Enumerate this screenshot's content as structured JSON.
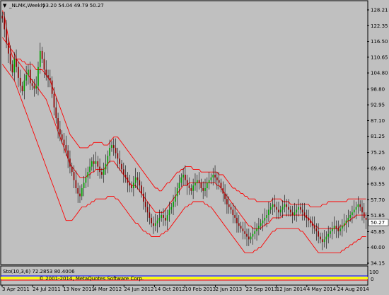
{
  "window": {
    "symbol_title": "_NLMK,Weekly",
    "ohlc": "53.20 54.04 49.79 50.27",
    "current_price": "50.27",
    "copyright": "© 2001-2014, MetaQuotes Software Corp."
  },
  "subwindow": {
    "indicator_label": "Sto(10,3,6) 72.2853 80.4006",
    "max_label": "100",
    "min_label": "0"
  },
  "colors": {
    "background": "#c0c0c0",
    "bollinger": "#ff0000",
    "bull_candle": "#00a000",
    "bear_candle": "#8b0000",
    "grid": "#ffffff",
    "stochastic_main": "#0000ff",
    "stochastic_signal": "#ff0000"
  },
  "chart_data": {
    "type": "candlestick",
    "y_axis_labels": [
      "128.21",
      "122.35",
      "116.50",
      "110.65",
      "104.80",
      "98.80",
      "92.95",
      "87.10",
      "81.25",
      "75.25",
      "69.40",
      "63.55",
      "57.70",
      "51.85",
      "45.85",
      "40.00",
      "34.15"
    ],
    "x_axis_labels": [
      "3 Apr 2011",
      "24 Jul 2011",
      "13 Nov 2011",
      "4 Mar 2012",
      "24 Jun 2012",
      "14 Oct 2012",
      "10 Feb 2013",
      "2 Jun 2013",
      "22 Sep 2013",
      "12 Jan 2014",
      "4 May 2014",
      "24 Aug 2014"
    ],
    "ylim": [
      34.15,
      128.21
    ],
    "last_price": 50.27,
    "close_series": [
      125,
      121,
      116,
      112,
      108,
      105,
      110,
      107,
      103,
      100,
      98,
      102,
      104,
      106,
      101,
      100,
      99,
      100,
      107,
      113,
      110,
      106,
      104,
      103,
      102,
      97,
      92,
      88,
      84,
      82,
      80,
      78,
      76,
      73,
      70,
      68,
      65,
      62,
      60,
      59,
      62,
      64,
      66,
      68,
      70,
      72,
      71,
      72,
      70,
      68,
      67,
      69,
      71,
      74,
      77,
      78,
      77,
      75,
      73,
      71,
      69,
      67,
      66,
      64,
      63,
      62,
      64,
      66,
      65,
      63,
      60,
      57,
      55,
      53,
      51,
      49,
      48,
      49,
      50,
      51,
      52,
      51,
      50,
      52,
      54,
      55,
      57,
      59,
      62,
      64,
      66,
      67,
      65,
      63,
      62,
      61,
      63,
      64,
      65,
      64,
      62,
      61,
      62,
      64,
      65,
      66,
      67,
      66,
      65,
      64,
      62,
      60,
      58,
      56,
      55,
      54,
      52,
      51,
      49,
      48,
      47,
      46,
      45,
      44,
      43,
      44,
      45,
      46,
      47,
      48,
      49,
      50,
      51,
      52,
      54,
      55,
      56,
      55,
      54,
      53,
      54,
      55,
      56,
      55,
      54,
      53,
      52,
      53,
      54,
      55,
      54,
      53,
      52,
      51,
      50,
      49,
      48,
      47,
      46,
      44,
      43,
      42,
      43,
      44,
      45,
      46,
      47,
      48,
      47,
      46,
      47,
      48,
      49,
      50,
      51,
      52,
      53,
      54,
      55,
      56,
      55,
      53,
      51,
      50.27
    ],
    "bollinger_upper_series": [
      128,
      126,
      122,
      118,
      114,
      111,
      110,
      110,
      110,
      110,
      109,
      109,
      108,
      108,
      108,
      108,
      107,
      106,
      106,
      106,
      106,
      105,
      104,
      103,
      102,
      100,
      98,
      96,
      94,
      92,
      90,
      88,
      86,
      84,
      82,
      81,
      80,
      79,
      78,
      77,
      77,
      77,
      77,
      77,
      78,
      78,
      79,
      79,
      79,
      79,
      79,
      78,
      78,
      78,
      79,
      80,
      81,
      81,
      81,
      80,
      79,
      78,
      77,
      76,
      75,
      74,
      73,
      72,
      71,
      70,
      69,
      68,
      67,
      66,
      65,
      64,
      63,
      62,
      62,
      61,
      61,
      62,
      63,
      64,
      64,
      65,
      66,
      67,
      68,
      68,
      69,
      69,
      70,
      70,
      70,
      70,
      69,
      69,
      69,
      69,
      68,
      68,
      68,
      68,
      68,
      68,
      68,
      68,
      68,
      67,
      67,
      67,
      66,
      65,
      64,
      63,
      62,
      62,
      61,
      61,
      60,
      60,
      59,
      59,
      58,
      58,
      58,
      58,
      57,
      57,
      57,
      57,
      57,
      57,
      57,
      57,
      58,
      58,
      58,
      58,
      58,
      57,
      57,
      57,
      57,
      56,
      56,
      56,
      56,
      56,
      56,
      56,
      56,
      56,
      56,
      55,
      55,
      55,
      55,
      55,
      55,
      56,
      56,
      56,
      57,
      57,
      57,
      57,
      57,
      57,
      57,
      57,
      57,
      57,
      58,
      58,
      58,
      58,
      58,
      58,
      58,
      58,
      58,
      58
    ],
    "bollinger_middle_series": [
      118,
      117,
      116,
      115,
      114,
      113,
      112,
      110,
      109,
      108,
      107,
      106,
      105,
      104,
      103,
      102,
      101,
      100,
      99,
      98,
      97,
      96,
      95,
      93,
      91,
      89,
      87,
      85,
      83,
      81,
      79,
      77,
      75,
      73,
      71,
      70,
      69,
      68,
      67,
      66,
      66,
      66,
      66,
      67,
      67,
      68,
      68,
      69,
      69,
      69,
      69,
      69,
      70,
      71,
      72,
      72,
      72,
      71,
      70,
      69,
      68,
      67,
      66,
      65,
      64,
      63,
      63,
      63,
      62,
      61,
      60,
      59,
      58,
      57,
      56,
      55,
      54,
      53,
      53,
      53,
      53,
      53,
      54,
      55,
      56,
      57,
      58,
      59,
      60,
      61,
      62,
      63,
      63,
      63,
      64,
      64,
      64,
      64,
      64,
      64,
      64,
      64,
      64,
      64,
      64,
      64,
      64,
      64,
      63,
      63,
      62,
      61,
      60,
      59,
      58,
      57,
      56,
      55,
      54,
      53,
      52,
      51,
      50,
      49,
      48,
      48,
      47,
      47,
      47,
      47,
      47,
      48,
      48,
      49,
      49,
      50,
      51,
      51,
      51,
      51,
      51,
      52,
      52,
      52,
      52,
      52,
      52,
      52,
      52,
      52,
      52,
      52,
      52,
      51,
      51,
      50,
      49,
      48,
      48,
      47,
      47,
      47,
      47,
      47,
      47,
      47,
      47,
      47,
      47,
      47,
      48,
      48,
      48,
      49,
      50,
      50,
      51,
      51,
      52,
      52,
      52,
      52,
      52,
      52
    ],
    "bollinger_lower_series": [
      108,
      107,
      106,
      105,
      104,
      103,
      102,
      100,
      98,
      96,
      94,
      92,
      90,
      88,
      86,
      84,
      82,
      80,
      78,
      76,
      74,
      72,
      70,
      68,
      66,
      64,
      62,
      60,
      58,
      56,
      54,
      52,
      50,
      50,
      50,
      50,
      51,
      52,
      53,
      54,
      55,
      55,
      55,
      56,
      56,
      57,
      57,
      58,
      58,
      58,
      58,
      58,
      58,
      59,
      59,
      59,
      59,
      58,
      58,
      57,
      56,
      55,
      54,
      53,
      52,
      51,
      50,
      49,
      49,
      48,
      47,
      46,
      46,
      45,
      45,
      44,
      44,
      44,
      44,
      44,
      45,
      45,
      46,
      46,
      47,
      48,
      49,
      50,
      51,
      52,
      53,
      54,
      55,
      55,
      56,
      56,
      57,
      57,
      57,
      57,
      57,
      57,
      56,
      56,
      55,
      55,
      54,
      53,
      52,
      51,
      50,
      49,
      48,
      47,
      46,
      45,
      44,
      43,
      42,
      41,
      40,
      39,
      38,
      38,
      38,
      38,
      38,
      39,
      39,
      40,
      40,
      41,
      42,
      43,
      44,
      45,
      46,
      46,
      47,
      47,
      47,
      47,
      47,
      47,
      47,
      47,
      47,
      47,
      47,
      47,
      46,
      46,
      45,
      44,
      43,
      42,
      41,
      40,
      39,
      38,
      38,
      38,
      38,
      38,
      38,
      38,
      38,
      38,
      38,
      38,
      38,
      39,
      39,
      40,
      40,
      41,
      41,
      42,
      42,
      43,
      43,
      44,
      44,
      44
    ]
  }
}
